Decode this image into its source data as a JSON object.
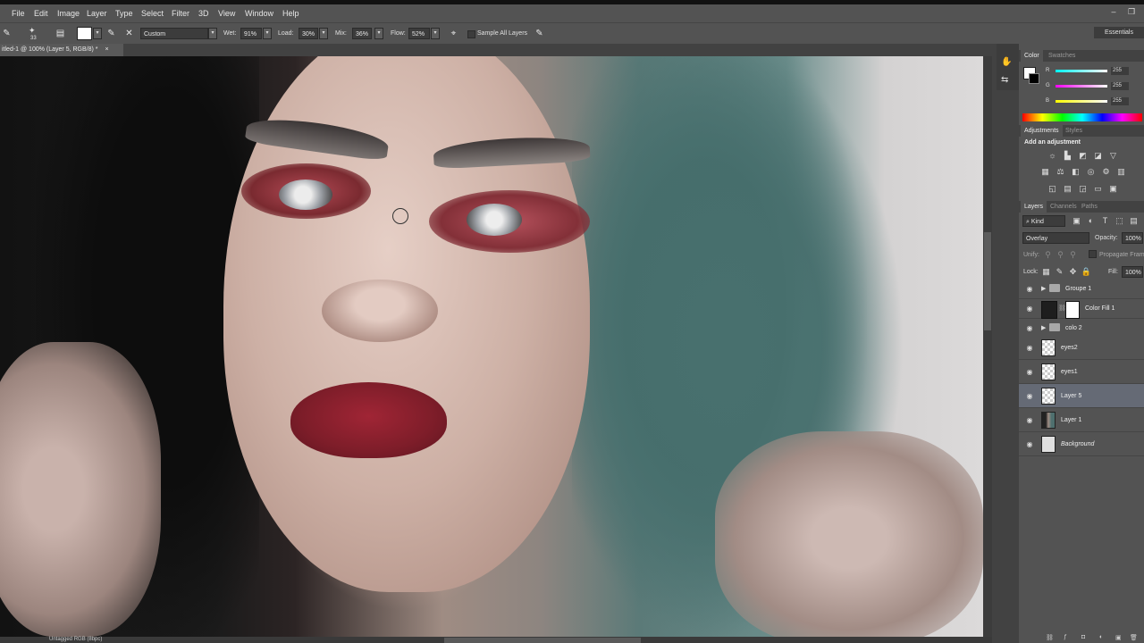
{
  "menubar": {
    "items": [
      "File",
      "Edit",
      "Image",
      "Layer",
      "Type",
      "Select",
      "Filter",
      "3D",
      "View",
      "Window",
      "Help"
    ]
  },
  "options_bar": {
    "brush_size": "33",
    "preset": "Custom",
    "wet_label": "Wet:",
    "wet_value": "91%",
    "load_label": "Load:",
    "load_value": "30%",
    "mix_label": "Mix:",
    "mix_value": "36%",
    "flow_label": "Flow:",
    "flow_value": "52%",
    "sample_all_layers": "Sample All Layers",
    "workspace": "Essentials"
  },
  "document": {
    "tab_title": "itled-1 @ 100% (Layer 5, RGB/8) *",
    "status_text": "Untagged RGB (8bpc)"
  },
  "color_panel": {
    "tabs": [
      "Color",
      "Swatches"
    ],
    "active_tab": "Color",
    "channels": [
      {
        "label": "R",
        "value": "255",
        "color": "#ff0000"
      },
      {
        "label": "G",
        "value": "255",
        "color": "#00ff00"
      },
      {
        "label": "B",
        "value": "255",
        "color": "#0000ff"
      }
    ]
  },
  "adjustments_panel": {
    "tabs": [
      "Adjustments",
      "Styles"
    ],
    "active_tab": "Adjustments",
    "heading": "Add an adjustment"
  },
  "layers_panel": {
    "tabs": [
      "Layers",
      "Channels",
      "Paths"
    ],
    "active_tab": "Layers",
    "filter_kind": "Kind",
    "blend_mode": "Overlay",
    "opacity_label": "Opacity:",
    "opacity_value": "100%",
    "unify_label": "Unify:",
    "propagate_label": "Propagate Frame",
    "lock_label": "Lock:",
    "fill_label": "Fill:",
    "fill_value": "100%",
    "layers": [
      {
        "name": "Groupe 1",
        "type": "group",
        "selected": false
      },
      {
        "name": "Color Fill 1",
        "type": "fill",
        "selected": false
      },
      {
        "name": "colo 2",
        "type": "group",
        "selected": false
      },
      {
        "name": "eyes2",
        "type": "pixel",
        "selected": false
      },
      {
        "name": "eyes1",
        "type": "pixel",
        "selected": false
      },
      {
        "name": "Layer 5",
        "type": "pixel",
        "selected": true
      },
      {
        "name": "Layer 1",
        "type": "photo",
        "selected": false
      },
      {
        "name": "Background",
        "type": "background",
        "selected": false
      }
    ]
  },
  "icons": {
    "brush": "brush-icon",
    "eye": "eye-icon",
    "folder": "folder-icon",
    "close": "close-icon"
  }
}
